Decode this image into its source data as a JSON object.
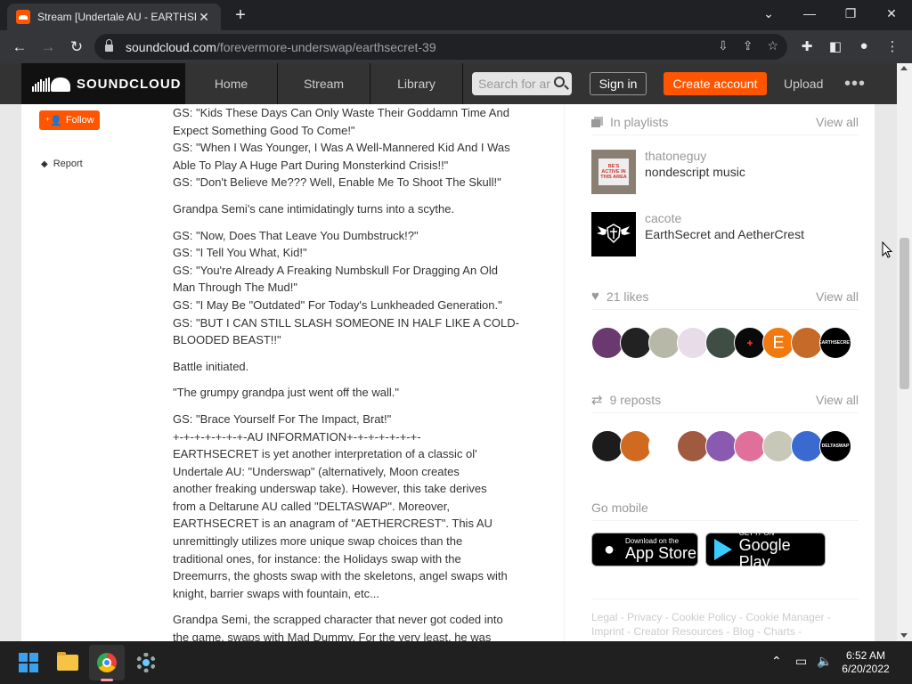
{
  "browser": {
    "tab_title": "Stream [Undertale AU - EARTHSE",
    "tab_close": "✕",
    "new_tab": "+",
    "url_host": "soundcloud.com",
    "url_path": "/forevermore-underswap/earthsecret-39",
    "win_minimize": "—",
    "win_restore": "❐",
    "win_close": "✕",
    "tabs_dropdown": "⌄"
  },
  "header": {
    "logo_text": "SOUNDCLOUD",
    "nav": [
      "Home",
      "Stream",
      "Library"
    ],
    "search_placeholder": "Search for ar",
    "sign_in": "Sign in",
    "create_account": "Create account",
    "upload": "Upload",
    "more": "•••"
  },
  "left": {
    "follow": "Follow",
    "report": "Report"
  },
  "description": {
    "paragraphs": [
      [
        "GS: \"Kids These Days Can Only Waste Their Goddamn Time And",
        "Expect Something Good To Come!\"",
        "GS: \"When I Was Younger, I Was A Well-Mannered Kid And I Was",
        "Able To Play A Huge Part During Monsterkind Crisis!!\"",
        "GS: \"Don't Believe Me??? Well, Enable Me To Shoot The Skull!\""
      ],
      [
        "Grandpa Semi's cane intimidatingly turns into a scythe."
      ],
      [
        "GS: \"Now, Does That Leave You Dumbstruck!?\"",
        "GS: \"I Tell You What, Kid!\"",
        "GS: \"You're Already A Freaking Numbskull For Dragging An Old",
        "Man Through The Mud!\"",
        "GS: \"I May Be \"Outdated\" For Today's Lunkheaded Generation.\"",
        "GS: \"BUT I CAN STILL SLASH SOMEONE IN HALF LIKE A COLD-",
        "BLOODED BEAST!!\""
      ],
      [
        "Battle initiated."
      ],
      [
        "\"The grumpy grandpa just went off the wall.\""
      ],
      [
        "GS: \"Brace Yourself For The Impact, Brat!\"",
        "+-+-+-+-+-+-+-AU INFORMATION+-+-+-+-+-+-+-",
        "EARTHSECRET is yet another interpretation of a classic ol'",
        "Undertale AU: \"Underswap\" (alternatively, Moon creates",
        "another freaking underswap take). However, this take derives",
        "from a Deltarune AU called \"DELTASWAP\". Moreover,",
        "EARTHSECRET is an anagram of \"AETHERCREST\". This AU",
        "unremittingly utilizes more unique swap choices than the",
        "traditional ones, for instance: the Holidays swap with the",
        "Dreemurrs, the ghosts swap with the skeletons, angel swaps with",
        "knight, barrier swaps with fountain, etc..."
      ],
      [
        "Grandpa Semi, the scrapped character that never got coded into",
        "the game, swaps with Mad Dummy. For the very least, he was"
      ]
    ]
  },
  "sidebar": {
    "playlists_header": "In playlists",
    "view_all": "View all",
    "playlists": [
      {
        "user": "thatoneguy",
        "title": "nondescript music",
        "art_text": "BE'S ACTIVE IN THIS AREA"
      },
      {
        "user": "cacote",
        "title": "EarthSecret and AetherCrest"
      }
    ],
    "likes_header": "21 likes",
    "reposts_header": "9 reposts",
    "like_avatar_E": "E",
    "like_avatar_last": "EARTHSECRET",
    "repost_avatar_last": "DELTASWAP",
    "go_mobile": "Go mobile",
    "app_store_small": "Download on the",
    "app_store_big": "App Store",
    "play_small": "GET IT ON",
    "play_big": "Google Play",
    "footer": "Legal - Privacy - Cookie Policy - Cookie Manager - Imprint - Creator Resources - Blog - Charts -"
  },
  "taskbar": {
    "time": "6:52 AM",
    "date": "6/20/2022"
  },
  "colors": {
    "accent": "#ff5500",
    "header_bg": "#333333",
    "browser_bg": "#202124"
  }
}
